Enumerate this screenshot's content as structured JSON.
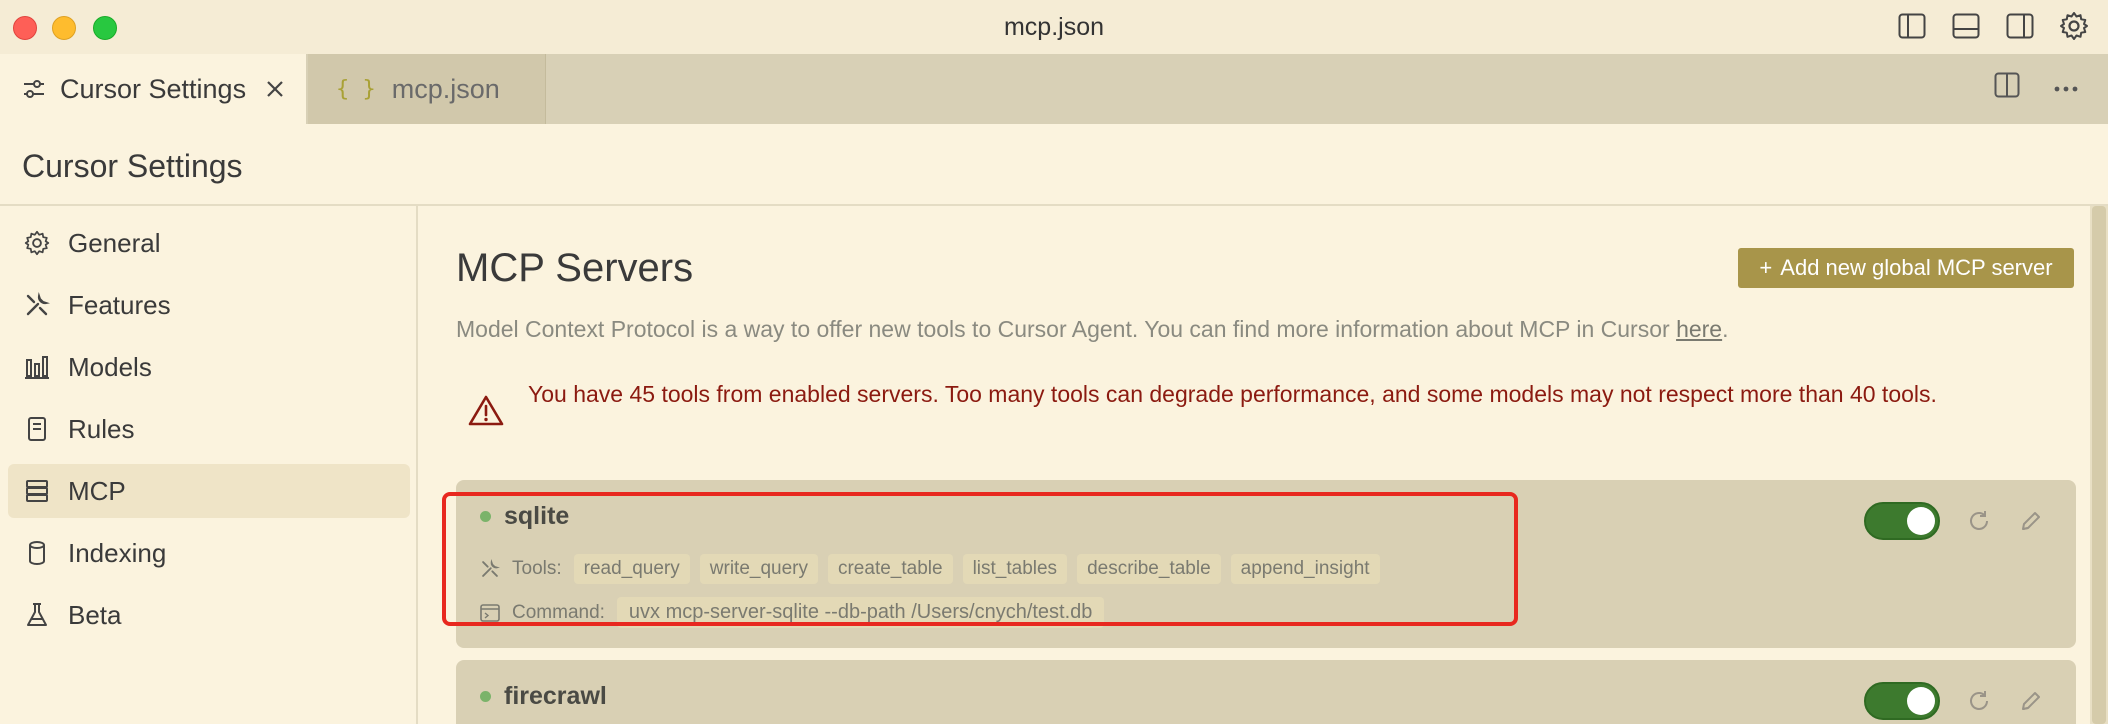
{
  "window": {
    "title": "mcp.json"
  },
  "tabs": [
    {
      "label": "Cursor Settings",
      "active": true
    },
    {
      "label": "mcp.json",
      "active": false,
      "icon": "{ }"
    }
  ],
  "settings": {
    "title": "Cursor Settings"
  },
  "sidebar": {
    "items": [
      {
        "label": "General",
        "icon": "gear-icon"
      },
      {
        "label": "Features",
        "icon": "tools-icon"
      },
      {
        "label": "Models",
        "icon": "bar-chart-icon"
      },
      {
        "label": "Rules",
        "icon": "notebook-icon"
      },
      {
        "label": "MCP",
        "icon": "server-stack-icon",
        "active": true
      },
      {
        "label": "Indexing",
        "icon": "database-icon"
      },
      {
        "label": "Beta",
        "icon": "flask-icon"
      }
    ]
  },
  "main": {
    "title": "MCP Servers",
    "add_button": "Add new global MCP server",
    "description": "Model Context Protocol is a way to offer new tools to Cursor Agent. You can find more information about MCP in Cursor ",
    "description_link": "here",
    "description_end": ".",
    "warning": "You have 45 tools from enabled servers. Too many tools can degrade performance, and some models may not respect more than 40 tools.",
    "tools_label": "Tools:",
    "command_label": "Command:",
    "servers": [
      {
        "name": "sqlite",
        "enabled": true,
        "tools": [
          "read_query",
          "write_query",
          "create_table",
          "list_tables",
          "describe_table",
          "append_insight"
        ],
        "command": "uvx mcp-server-sqlite --db-path /Users/cnych/test.db"
      },
      {
        "name": "firecrawl",
        "enabled": true
      }
    ]
  },
  "colors": {
    "accent": "#a8954a",
    "toggle_on": "#3d7a2e",
    "warning": "#8b1a10",
    "highlight": "#e8281f",
    "status_ok": "#7bb36a"
  }
}
